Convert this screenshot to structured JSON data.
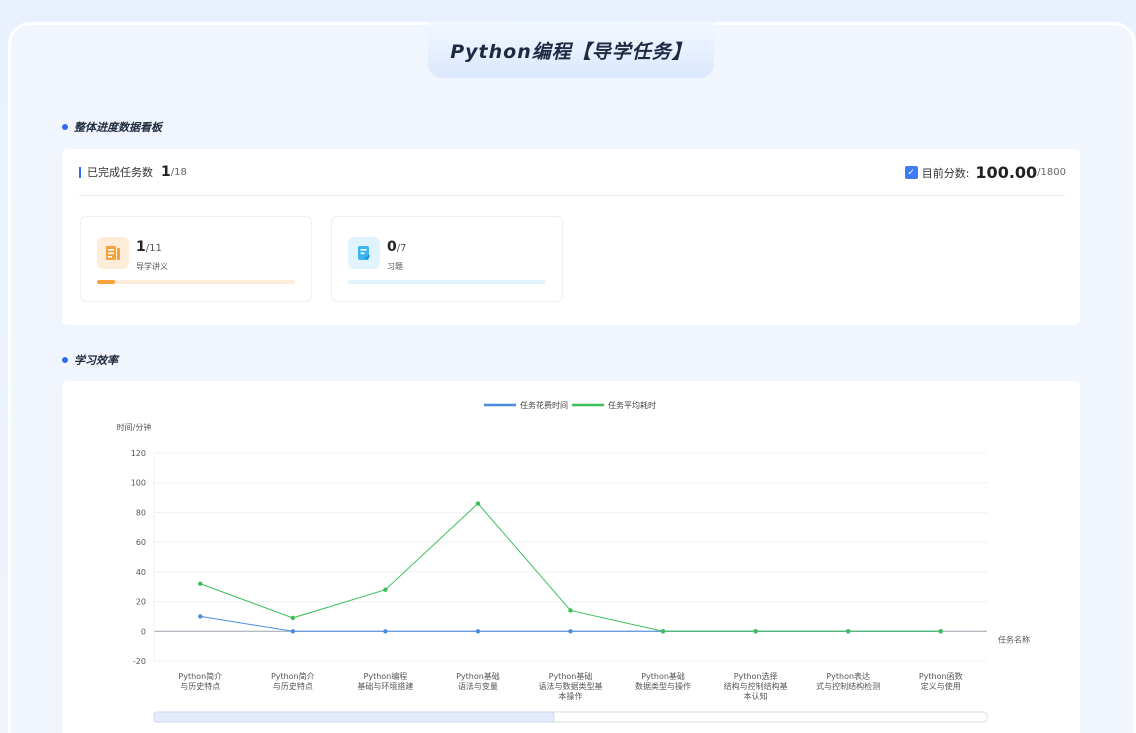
{
  "page_title": "Python编程【导学任务】",
  "sections": {
    "overview_title": "整体进度数据看板",
    "efficiency_title": "学习效率"
  },
  "summary": {
    "completed_label": "已完成任务数",
    "completed_value": "1",
    "completed_total": "/18",
    "score_label": "目前分数:",
    "score_value": "100.00",
    "score_total": "/1800"
  },
  "stats": [
    {
      "value": "1",
      "total": "/11",
      "label": "导学讲义",
      "progress": 0.09,
      "color": "#f5a23c",
      "track": "#fdecd8",
      "icon": "document-icon"
    },
    {
      "value": "0",
      "total": "/7",
      "label": "习题",
      "progress": 0,
      "color": "#3ab4f2",
      "track": "#e1f3fd",
      "icon": "exercise-icon"
    }
  ],
  "colors": {
    "accent": "#2f6bf2",
    "series1": "#4a8de0",
    "series2": "#3cbf5a"
  },
  "chart_data": {
    "type": "line",
    "ylabel": "时间/分钟",
    "xlabel": "任务名称",
    "ylim": [
      -20,
      120
    ],
    "yticks": [
      -20,
      0,
      20,
      40,
      60,
      80,
      100,
      120
    ],
    "categories": [
      [
        "Python简介",
        "与历史特点"
      ],
      [
        "Python简介",
        "与历史特点"
      ],
      [
        "Python编程",
        "基础与环境搭建"
      ],
      [
        "Python基础",
        "语法与变量"
      ],
      [
        "Python基础",
        "语法与数据类型基",
        "本操作"
      ],
      [
        "Python基础",
        "数据类型与操作"
      ],
      [
        "Python选择",
        "结构与控制结构基",
        "本认知"
      ],
      [
        "Python表达",
        "式与控制结构检测"
      ],
      [
        "Python函数",
        "定义与使用"
      ]
    ],
    "series": [
      {
        "name": "任务花费时间",
        "color": "#4a8de0",
        "values": [
          10,
          0,
          0,
          0,
          0,
          0,
          0,
          0,
          0
        ]
      },
      {
        "name": "任务平均耗时",
        "color": "#3cbf5a",
        "values": [
          32,
          9,
          28,
          86,
          14,
          0,
          0,
          0,
          0
        ]
      }
    ],
    "legend_position": "top-center",
    "grid": true
  }
}
